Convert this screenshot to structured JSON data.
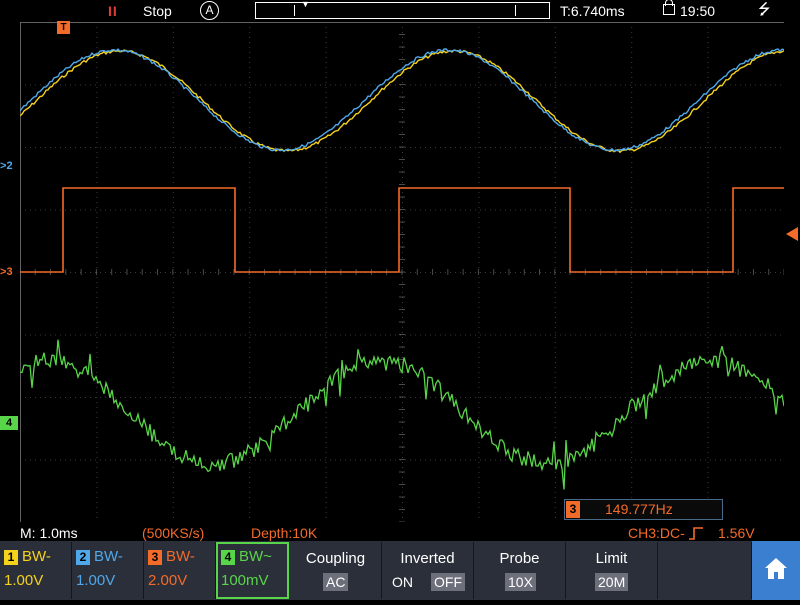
{
  "top_bar": {
    "run_indicator": "II",
    "run_state": "Stop",
    "trigger_mode": "A",
    "memory_pointer": "▼",
    "trigger_time": "T:6.740ms",
    "clock": "19:50",
    "usb_icon": "usb-icon"
  },
  "markers": {
    "trigger": "T",
    "ch2": "2",
    "ch3": "3",
    "ch4": "4"
  },
  "colors": {
    "ch1": "#f5d21b",
    "ch2": "#4fa8ea",
    "ch3": "#f36b28",
    "ch4": "#58d548",
    "grid": "#505050",
    "menu_bg": "#2b2f3a",
    "home": "#3a7fd0"
  },
  "status": {
    "timebase": "M: 1.0ms",
    "sample_rate": "(500KS/s)",
    "depth": "Depth:10K",
    "trigger_info": "CH3:DC-",
    "trigger_level": "1.56V",
    "freq_channel": "3",
    "frequency": "149.777Hz"
  },
  "channels": [
    {
      "num": "1",
      "bw": "BW-",
      "volts": "1.00V"
    },
    {
      "num": "2",
      "bw": "BW-",
      "volts": "1.00V"
    },
    {
      "num": "3",
      "bw": "BW-",
      "volts": "2.00V"
    },
    {
      "num": "4",
      "bw": "BW~",
      "volts": "100mV"
    }
  ],
  "menu": {
    "coupling": {
      "title": "Coupling",
      "value": "AC"
    },
    "inverted": {
      "title": "Inverted",
      "on": "ON",
      "off": "OFF"
    },
    "probe": {
      "title": "Probe",
      "value": "10X"
    },
    "limit": {
      "title": "Limit",
      "value": "20M"
    },
    "home_icon": "home-icon"
  }
}
